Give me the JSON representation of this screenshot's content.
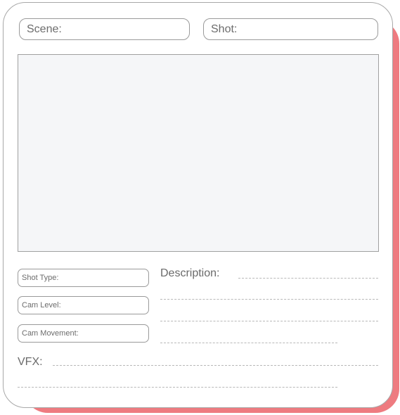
{
  "header": {
    "scene_label": "Scene:",
    "shot_label": "Shot:"
  },
  "details": {
    "shot_type_label": "Shot Type:",
    "cam_level_label": "Cam Level:",
    "cam_movement_label": "Cam Movement:"
  },
  "notes": {
    "description_label": "Description:",
    "vfx_label": "VFX:"
  },
  "colors": {
    "accent_shadow": "#ee7b80",
    "frame_fill": "#f5f6f8",
    "outline": "#a8a8a8"
  }
}
